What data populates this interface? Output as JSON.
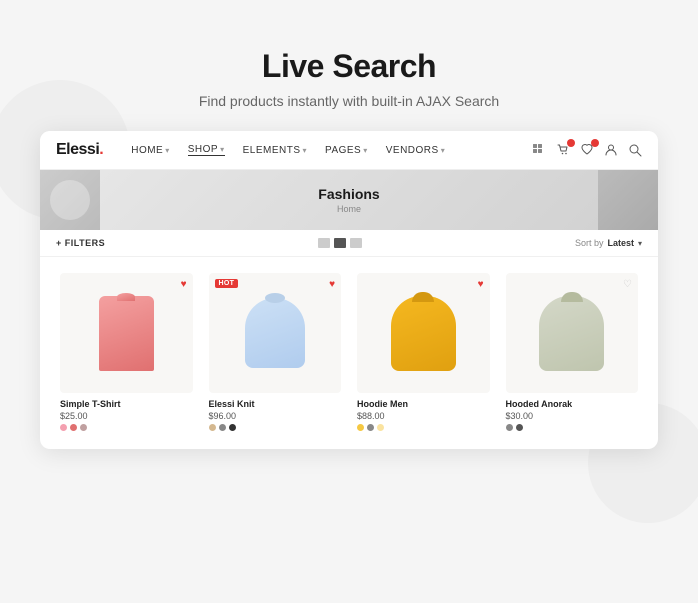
{
  "page": {
    "title": "Live Search",
    "subtitle": "Find products instantly with built-in AJAX Search"
  },
  "nav": {
    "logo": "Elessi.",
    "links": [
      {
        "label": "HOME",
        "hasChevron": true,
        "active": false
      },
      {
        "label": "SHOP",
        "hasChevron": true,
        "active": true
      },
      {
        "label": "ELEMENTS",
        "hasChevron": true,
        "active": false
      },
      {
        "label": "PAGES",
        "hasChevron": true,
        "active": false
      },
      {
        "label": "VENDORS",
        "hasChevron": true,
        "active": false
      }
    ]
  },
  "hero": {
    "title": "Fashions",
    "breadcrumb": "Home"
  },
  "filters": {
    "label": "+ FILTERS",
    "sort_label": "Sort by",
    "sort_value": "Latest"
  },
  "products": [
    {
      "name": "Simple T-Shirt",
      "price": "$25.00",
      "hot": false,
      "wishlisted": true,
      "colors": [
        "#f4a0b0",
        "#e07070",
        "#c0a0a0"
      ],
      "image_type": "shirt"
    },
    {
      "name": "Elessi Knit",
      "price": "$96.00",
      "hot": true,
      "wishlisted": true,
      "colors": [
        "#d4b890",
        "#888",
        "#333"
      ],
      "image_type": "sweater"
    },
    {
      "name": "Hoodie Men",
      "price": "$88.00",
      "hot": false,
      "wishlisted": true,
      "colors": [
        "#f5c842",
        "#888",
        "#f5c842"
      ],
      "image_type": "hoodie"
    },
    {
      "name": "Hooded Anorak",
      "price": "$30.00",
      "hot": false,
      "wishlisted": false,
      "colors": [
        "#888",
        "#555"
      ],
      "image_type": "anorak"
    }
  ],
  "view_toggles": [
    {
      "color": "#ccc"
    },
    {
      "color": "#555"
    },
    {
      "color": "#ccc"
    }
  ]
}
